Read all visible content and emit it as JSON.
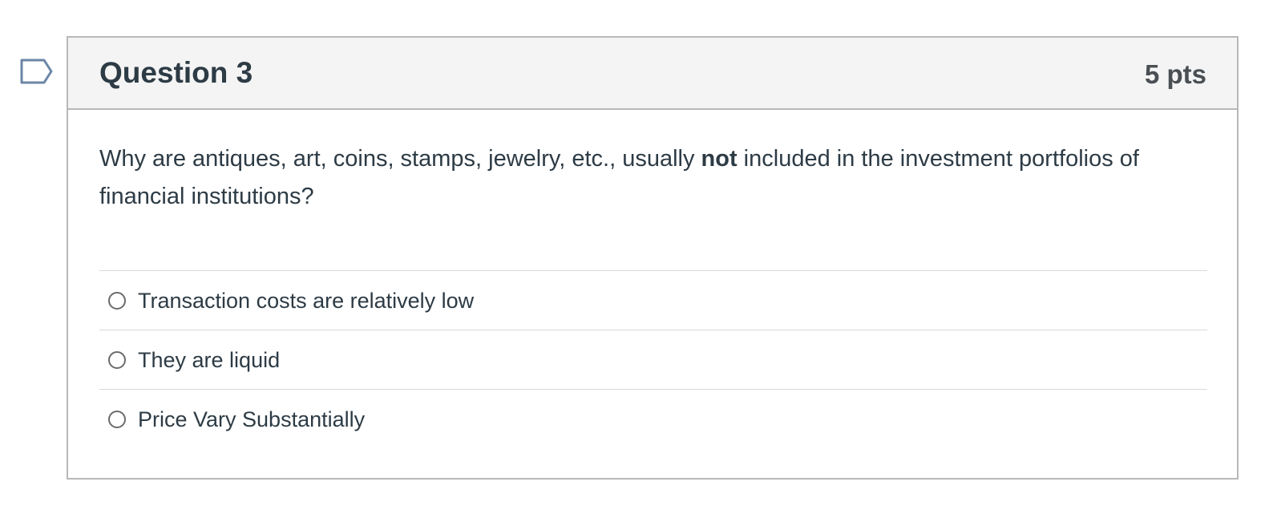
{
  "question": {
    "title": "Question 3",
    "points": "5 pts",
    "text_before": "Why are antiques, art, coins, stamps, jewelry, etc., usually ",
    "text_bold": "not",
    "text_after": " included in the investment portfolios of financial institutions?",
    "flag_icon": "flag-bookmark-icon",
    "answers": [
      {
        "label": "Transaction costs are relatively low",
        "selected": false
      },
      {
        "label": "They are liquid",
        "selected": false
      },
      {
        "label": "Price Vary Substantially",
        "selected": false
      }
    ]
  },
  "colors": {
    "text": "#2d3b45",
    "header_bg": "#f4f4f4",
    "border": "#b8b8b8",
    "flag": "#6b86a6"
  }
}
